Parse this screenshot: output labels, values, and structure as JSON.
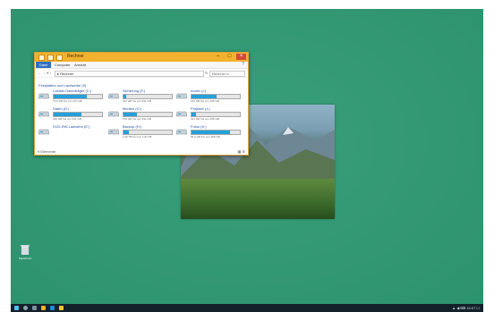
{
  "colors": {
    "desktop": "#2f9a73",
    "titlebar": "#f2b22e",
    "taskbar": "#14202a",
    "accent": "#26a0da"
  },
  "explorer": {
    "title": "Rechner",
    "controls": {
      "minimize": "–",
      "maximize": "□",
      "close": "×"
    },
    "ribbon": {
      "file": "Datei",
      "computer": "Computer",
      "view": "Ansicht",
      "help": "?"
    },
    "nav": "← → ▾ ↑",
    "address": "▸ Rechner",
    "refresh": "↻",
    "search_placeholder": "Rechner d...",
    "section": "Festplatten und Laufwerke (9)",
    "drives": [
      {
        "name": "Lokaler Datenträger (C:)",
        "size": "73,6 GB frei von 237 GB",
        "fill": 0.69
      },
      {
        "name": "Daten (D:)",
        "size": "392 GB frei von 931 GB",
        "fill": 0.58
      },
      {
        "name": "DVD-RW-Laufwerk (E:)",
        "size": "",
        "fill": null
      },
      {
        "name": "Sicherung (F:)",
        "size": "912 GB frei von 931 GB",
        "fill": 0.06
      },
      {
        "name": "Medien (G:)",
        "size": "678 GB frei von 931 GB",
        "fill": 0.27
      },
      {
        "name": "Backup (H:)",
        "size": "1,60 TB frei von 1,81 TB",
        "fill": 0.12
      },
      {
        "name": "Archiv (I:)",
        "size": "221 GB frei von 465 GB",
        "fill": 0.52
      },
      {
        "name": "Projekte (J:)",
        "size": "421 GB frei von 465 GB",
        "fill": 0.09
      },
      {
        "name": "Fotos (K:)",
        "size": "95,2 GB frei von 465 GB",
        "fill": 0.8
      }
    ],
    "status": "9 Elemente",
    "view_icons": "▦ ☰"
  },
  "recycle_bin": {
    "label": "Papierkorb",
    "icon": "recycle-bin-icon"
  },
  "taskbar": {
    "icons": [
      "start-icon",
      "search-icon",
      "task-view-icon",
      "explorer-icon",
      "browser-icon",
      "folder-icon"
    ],
    "tray": "▲ ◀ ⌨ 16:07 ☐"
  }
}
